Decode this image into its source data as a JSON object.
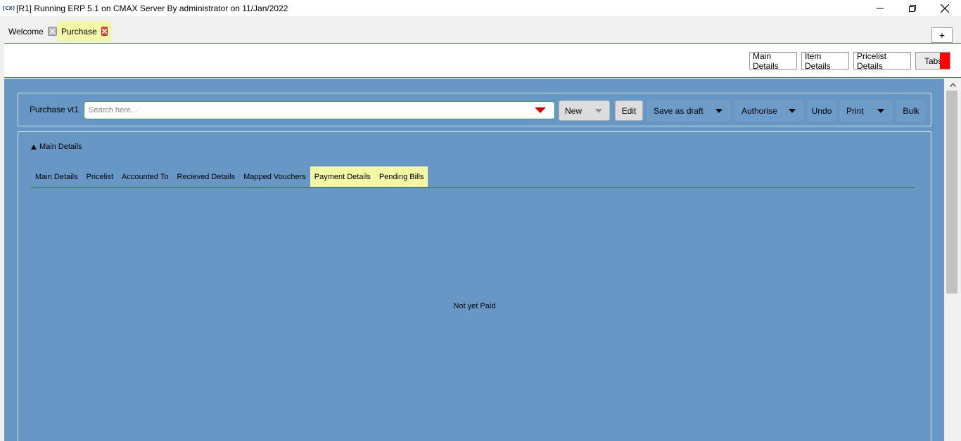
{
  "window": {
    "icon_text": "[CX]",
    "title": "[R1] Running ERP 5.1 on CMAX Server By administrator on 11/Jan/2022"
  },
  "tabs": [
    {
      "label": "Welcome",
      "active": false
    },
    {
      "label": "Purchase",
      "active": true
    }
  ],
  "add_tab_label": "+",
  "header": {
    "main_details": "Main Details",
    "item_details": "Item Details",
    "pricelist_details": "Pricelist Details",
    "tabs": "Tabs"
  },
  "toolbar": {
    "label": "Purchase vt1",
    "search_placeholder": "Search here...",
    "new": "New",
    "edit": "Edit",
    "save_as_draft": "Save as draft",
    "authorise": "Authorise",
    "undo": "Undo",
    "print": "Print",
    "bulk": "Bulk"
  },
  "section": {
    "title": "Main Details",
    "subtabs": [
      "Main Details",
      "Pricelist",
      "Accounted To",
      "Recieved Details",
      "Mapped Vouchers",
      "Payment Details",
      "Pending Bills"
    ],
    "empty_message": "Not yet Paid"
  },
  "colors": {
    "main_bg": "#6797c4",
    "highlight": "#f4f7a6",
    "accent_green": "#2c6c31",
    "marker_red": "#ff0000"
  }
}
